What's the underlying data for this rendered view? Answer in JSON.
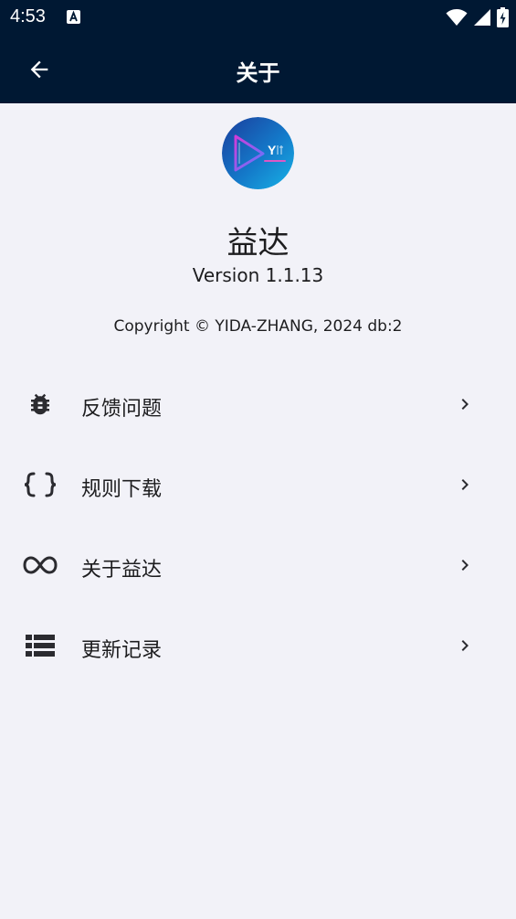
{
  "status_bar": {
    "time": "4:53",
    "notification_icon": "a-box-icon",
    "icons": [
      "wifi-icon",
      "cell-signal-icon",
      "battery-charging-icon"
    ]
  },
  "app_bar": {
    "title": "关于",
    "back_icon": "back-arrow-icon"
  },
  "about": {
    "logo_text": "Y",
    "app_name": "益达",
    "version": "Version 1.1.13",
    "copyright": "Copyright © YIDA-ZHANG, 2024 db:2"
  },
  "menu": {
    "items": [
      {
        "label": "反馈问题",
        "icon": "bug-icon"
      },
      {
        "label": "规则下载",
        "icon": "curly-braces-icon"
      },
      {
        "label": "关于益达",
        "icon": "infinity-icon"
      },
      {
        "label": "更新记录",
        "icon": "list-icon"
      }
    ],
    "chevron_icon": "chevron-right-icon"
  },
  "colors": {
    "header_bg": "#001833",
    "page_bg": "#f2f2f8",
    "text": "#1d1d1f",
    "icon": "#2b2b30"
  }
}
